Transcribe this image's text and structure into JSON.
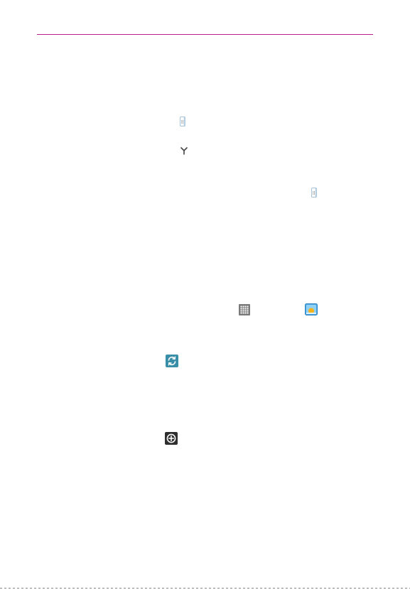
{
  "header": {
    "rule_color": "#b81f8a"
  },
  "icons": [
    {
      "name": "menu-icon"
    },
    {
      "name": "merge-icon"
    },
    {
      "name": "menu-icon"
    },
    {
      "name": "apps-grid-icon"
    },
    {
      "name": "gallery-icon"
    },
    {
      "name": "sync-icon"
    },
    {
      "name": "add-circle-icon"
    }
  ]
}
